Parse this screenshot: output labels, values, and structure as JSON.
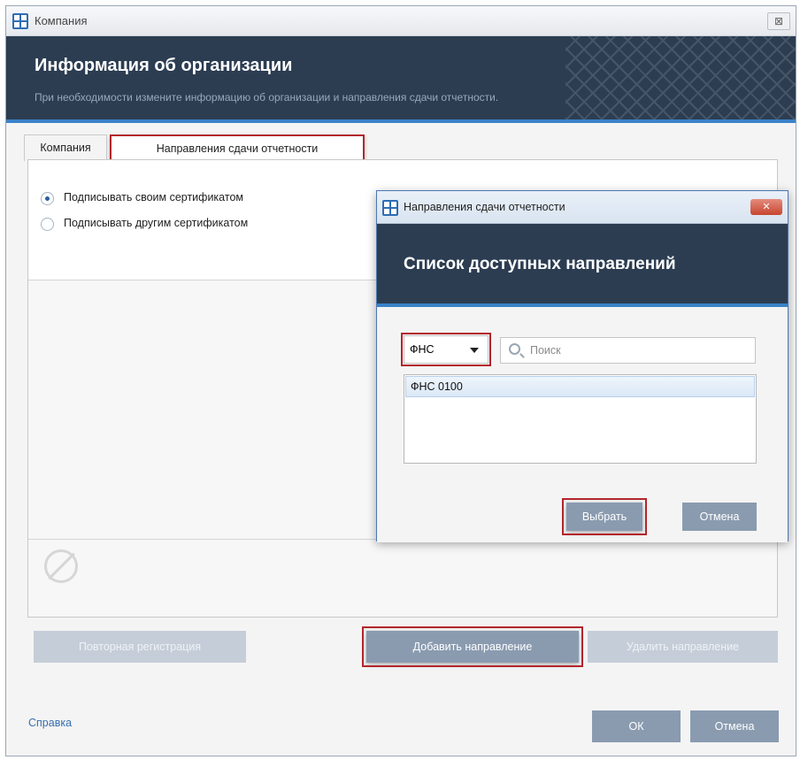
{
  "window": {
    "title": "Компания",
    "close_glyph": "⊠",
    "header_title": "Информация об организации",
    "header_subtitle": "При необходимости измените информацию об организации и направления сдачи отчетности."
  },
  "tabs": [
    {
      "label": "Компания",
      "active": false
    },
    {
      "label": "Направления сдачи отчетности",
      "active": true
    }
  ],
  "signing": {
    "options": [
      {
        "label": "Подписывать своим сертификатом",
        "selected": true
      },
      {
        "label": "Подписывать другим сертификатом",
        "selected": false
      }
    ]
  },
  "actions": {
    "reregister": "Повторная регистрация",
    "add_direction": "Добавить направление",
    "delete_direction": "Удалить направление"
  },
  "footer": {
    "help": "Справка",
    "ok": "ОК",
    "cancel": "Отмена"
  },
  "dialog": {
    "title": "Направления сдачи отчетности",
    "close_glyph": "✕",
    "header_title": "Список доступных направлений",
    "filter_value": "ФНС",
    "search_placeholder": "Поиск",
    "list_items": [
      "ФНС 0100"
    ],
    "select_button": "Выбрать",
    "cancel_button": "Отмена"
  },
  "colors": {
    "header_bg": "#2c3d52",
    "accent_stripe": "#3b82c9",
    "highlight_red": "#b3252c",
    "button_primary": "#8a9bb0",
    "button_disabled": "#c5ced8",
    "link": "#3770b0"
  },
  "icons": [
    "app-icon",
    "close-icon",
    "search-icon",
    "chevron-down-icon",
    "forbidden-icon"
  ]
}
